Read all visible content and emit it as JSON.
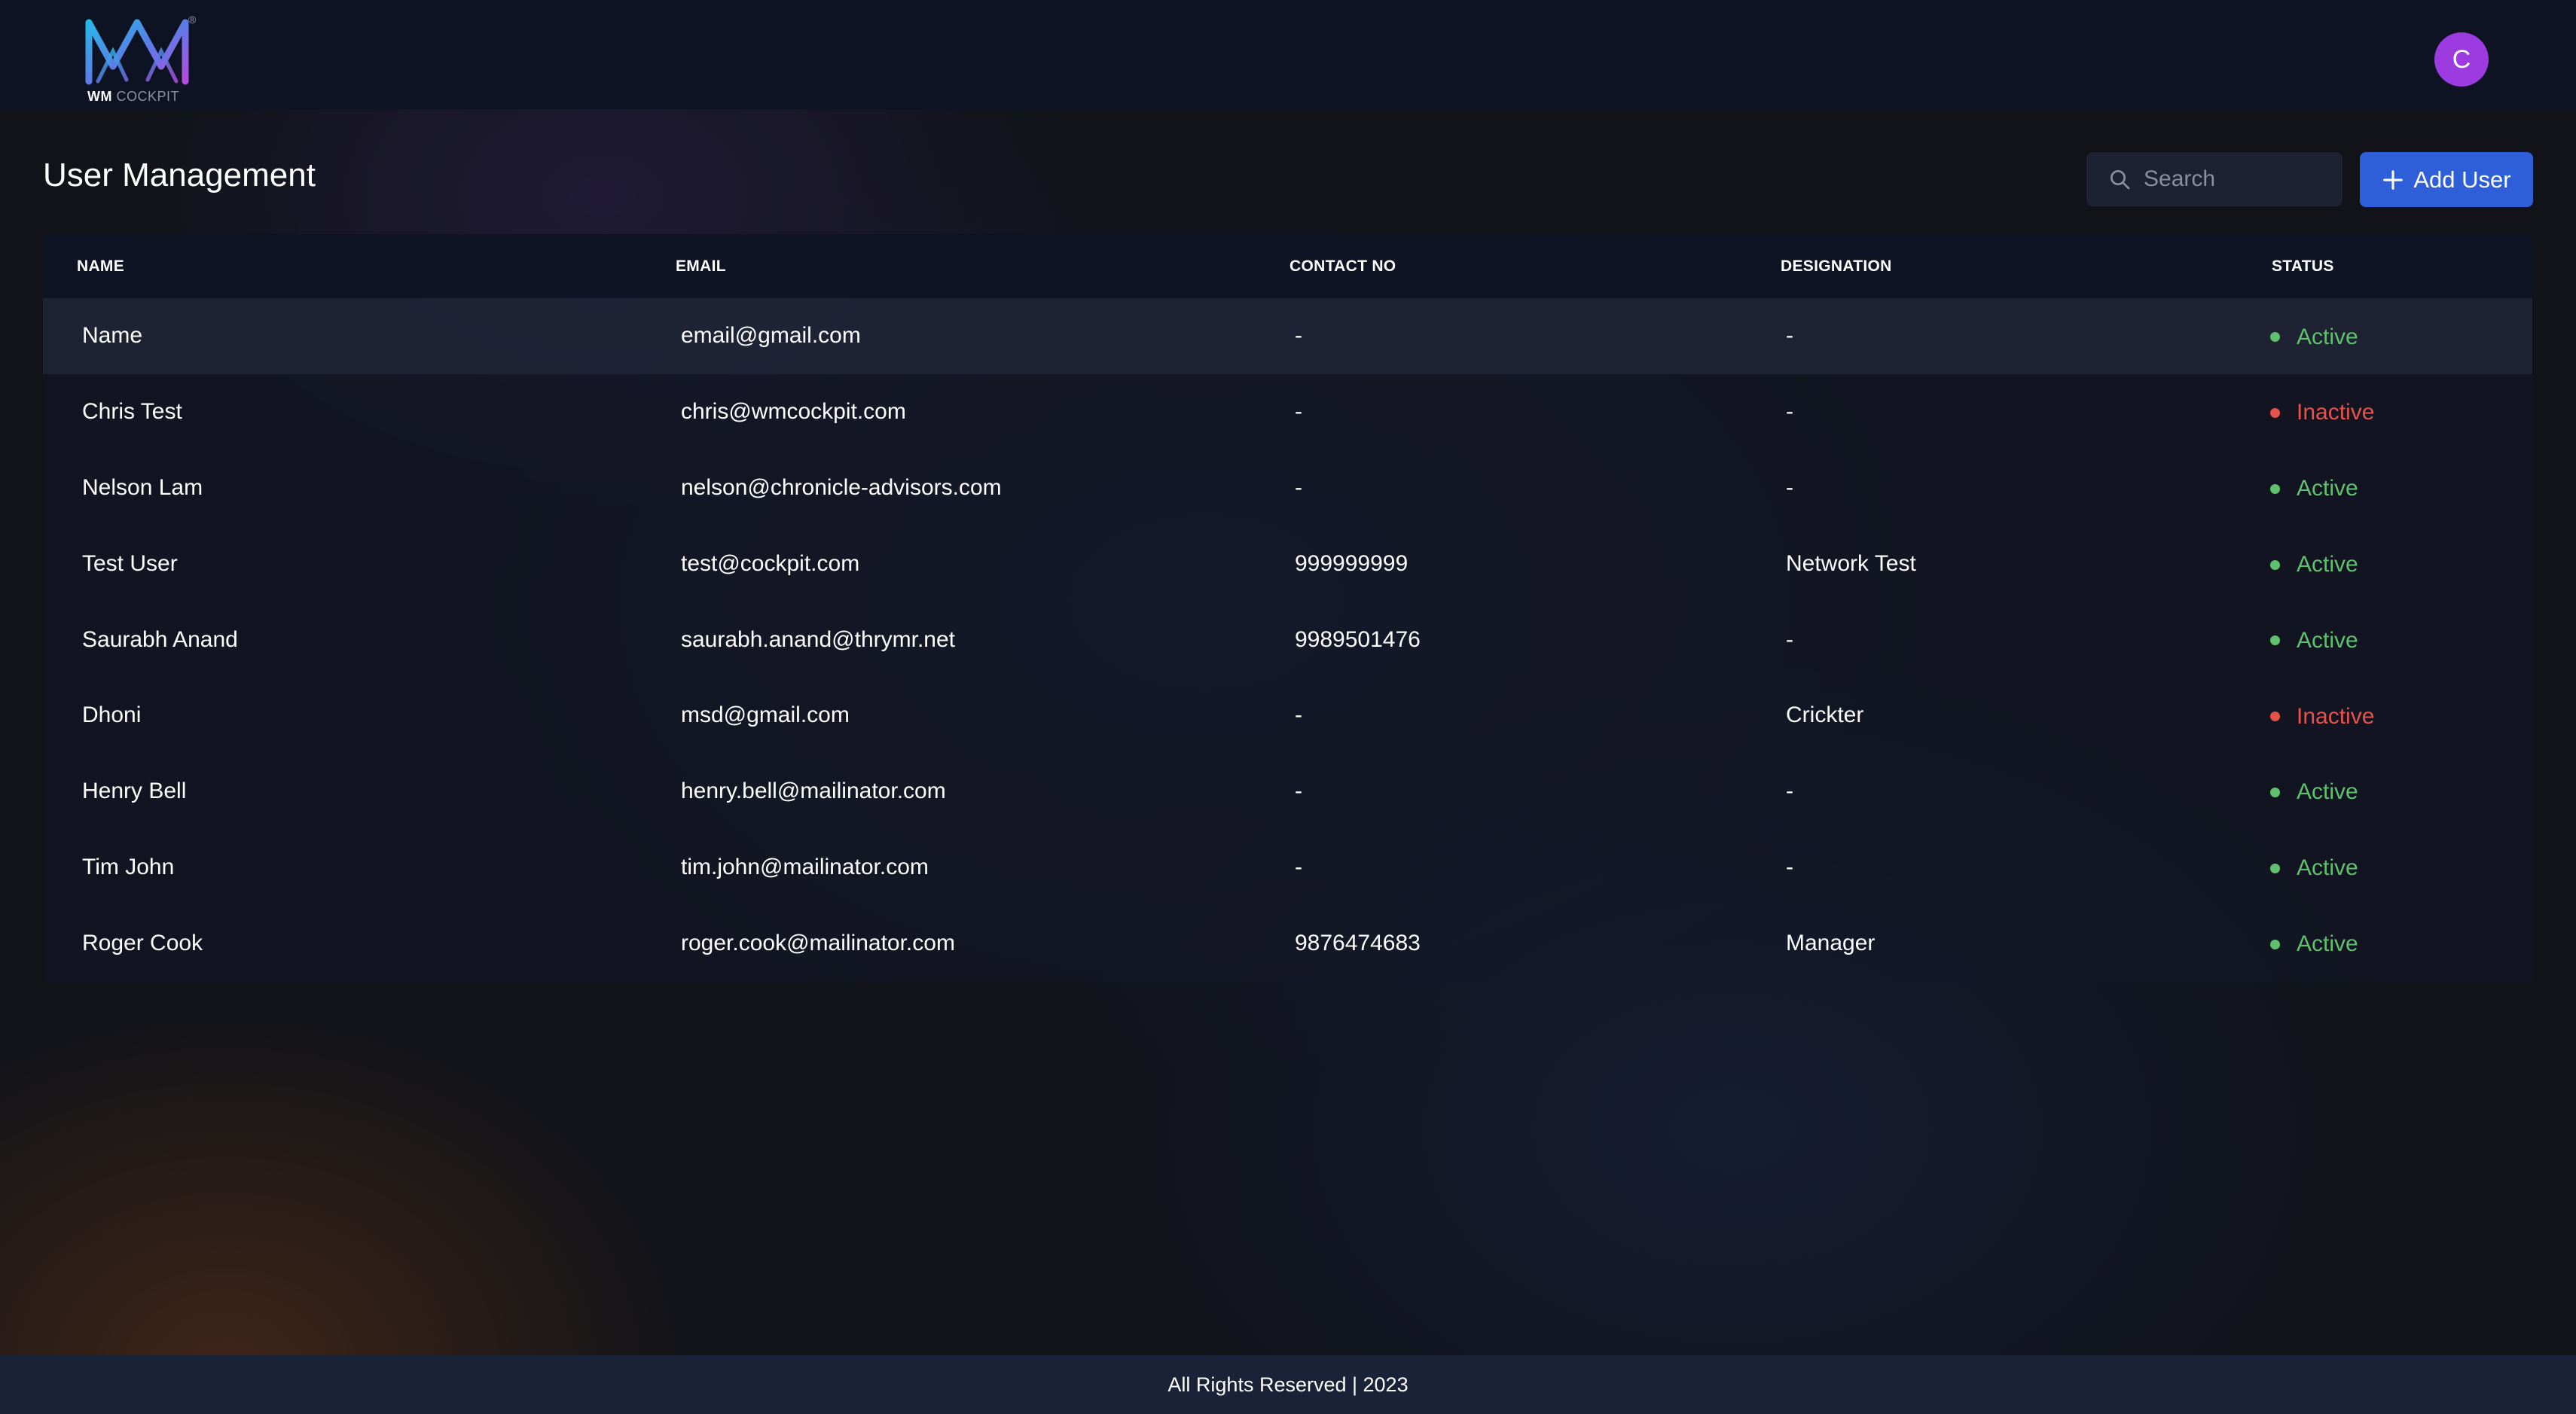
{
  "header": {
    "logo": {
      "brand_bold": "WM",
      "brand_light": "COCKPIT",
      "mark": "®"
    },
    "avatar_initial": "C"
  },
  "page": {
    "title": "User Management"
  },
  "toolbar": {
    "search_placeholder": "Search",
    "search_value": "",
    "add_user_label": "Add User"
  },
  "table": {
    "columns": [
      "NAME",
      "EMAIL",
      "CONTACT NO",
      "DESIGNATION",
      "STATUS"
    ],
    "rows": [
      {
        "name": "Name",
        "email": "email@gmail.com",
        "contact": "-",
        "designation": "-",
        "status": "Active"
      },
      {
        "name": "Chris Test",
        "email": "chris@wmcockpit.com",
        "contact": "-",
        "designation": "-",
        "status": "Inactive"
      },
      {
        "name": "Nelson Lam",
        "email": "nelson@chronicle-advisors.com",
        "contact": "-",
        "designation": "-",
        "status": "Active"
      },
      {
        "name": "Test User",
        "email": "test@cockpit.com",
        "contact": "999999999",
        "designation": "Network Test",
        "status": "Active"
      },
      {
        "name": "Saurabh Anand",
        "email": "saurabh.anand@thrymr.net",
        "contact": "9989501476",
        "designation": "-",
        "status": "Active"
      },
      {
        "name": "Dhoni",
        "email": "msd@gmail.com",
        "contact": "-",
        "designation": "Crickter",
        "status": "Inactive"
      },
      {
        "name": "Henry Bell",
        "email": "henry.bell@mailinator.com",
        "contact": "-",
        "designation": "-",
        "status": "Active"
      },
      {
        "name": "Tim John",
        "email": "tim.john@mailinator.com",
        "contact": "-",
        "designation": "-",
        "status": "Active"
      },
      {
        "name": "Roger Cook",
        "email": "roger.cook@mailinator.com",
        "contact": "9876474683",
        "designation": "Manager",
        "status": "Active"
      }
    ]
  },
  "status_colors": {
    "Active": "#5fc16d",
    "Inactive": "#e5534b"
  },
  "colors": {
    "accent": "#2f5fd8",
    "avatar": "#9b3be0",
    "header_bg": "#0d1323",
    "footer_bg": "#1a2238"
  },
  "icons": {
    "logo": "wm-cockpit-logo-icon",
    "search": "search-icon",
    "add": "plus-icon"
  },
  "footer": {
    "text": "All Rights Reserved | 2023"
  }
}
